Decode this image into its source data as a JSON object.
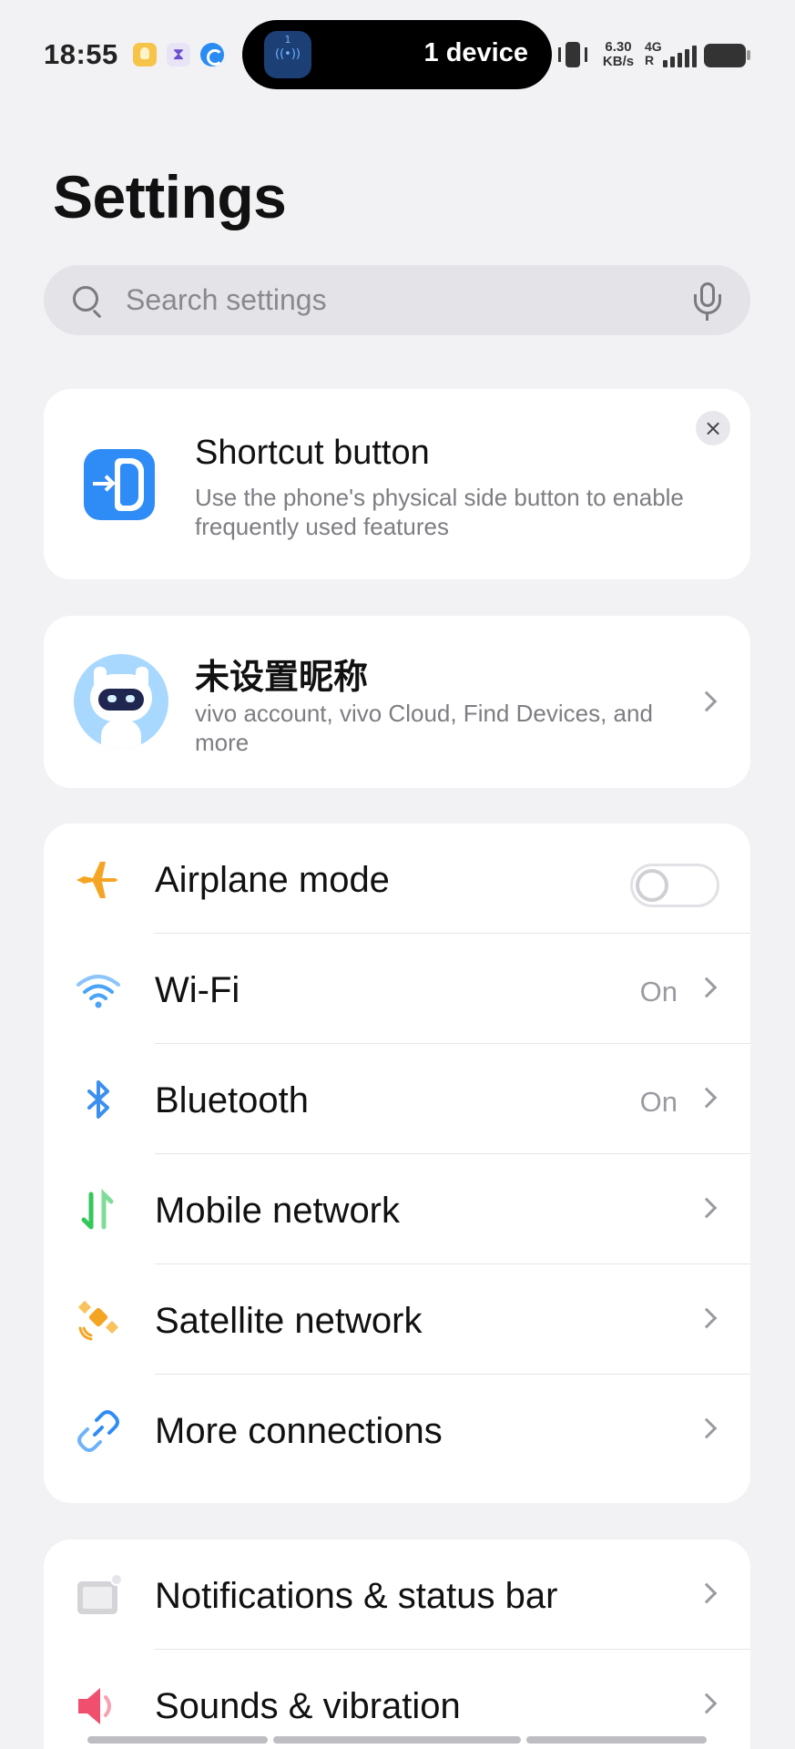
{
  "status_bar": {
    "time": "18:55",
    "island_text": "1 device",
    "island_badge": "1",
    "net_speed_value": "6.30",
    "net_speed_unit": "KB/s",
    "network_type": "4G",
    "roaming": "R"
  },
  "header": {
    "title": "Settings"
  },
  "search": {
    "placeholder": "Search settings"
  },
  "shortcut_card": {
    "title": "Shortcut button",
    "subtitle": "Use the phone's physical side button to enable frequently used features",
    "close_glyph": "×"
  },
  "account_card": {
    "name": "未设置昵称",
    "subtitle": "vivo account, vivo Cloud, Find Devices, and more"
  },
  "connections": [
    {
      "label": "Airplane mode",
      "value": "",
      "icon": "airplane-icon",
      "toggle": false
    },
    {
      "label": "Wi-Fi",
      "value": "On",
      "icon": "wifi-icon"
    },
    {
      "label": "Bluetooth",
      "value": "On",
      "icon": "bluetooth-icon"
    },
    {
      "label": "Mobile network",
      "value": "",
      "icon": "mobile-network-icon"
    },
    {
      "label": "Satellite network",
      "value": "",
      "icon": "satellite-icon"
    },
    {
      "label": "More connections",
      "value": "",
      "icon": "link-icon"
    }
  ],
  "system": [
    {
      "label": "Notifications & status bar",
      "icon": "notifications-icon"
    },
    {
      "label": "Sounds & vibration",
      "icon": "speaker-icon"
    }
  ],
  "colors": {
    "accent_blue": "#2f8cf6",
    "airplane": "#f5a524",
    "wifi": "#4aa3f7",
    "mobile_network_green": "#34c759",
    "satellite": "#f5a524",
    "link": "#2f8cf6",
    "speaker": "#f0506e"
  }
}
